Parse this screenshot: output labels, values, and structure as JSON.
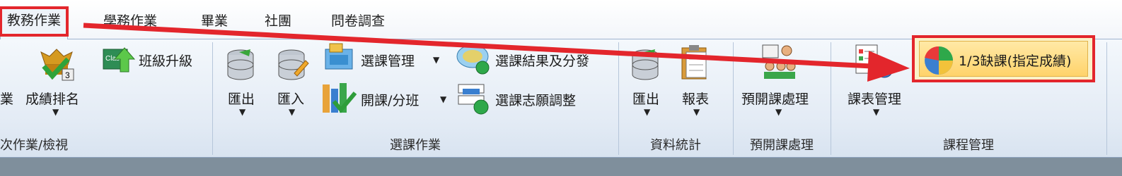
{
  "tabs": [
    {
      "label": "教務作業",
      "active": true
    },
    {
      "label": "學務作業"
    },
    {
      "label": "畢業"
    },
    {
      "label": "社團"
    },
    {
      "label": "問卷調查"
    }
  ],
  "group1": {
    "cut_label": "業",
    "rank_label": "成績排名",
    "promote_label": "班級升級",
    "group_label": "次作業/檢視"
  },
  "group2": {
    "export_label": "匯出",
    "import_label": "匯入",
    "manage_label": "選課管理",
    "open_label": "開課/分班",
    "result_label": "選課結果及分發",
    "adjust_label": "選課志願調整",
    "group_label": "選課作業"
  },
  "group3": {
    "export_label": "匯出",
    "report_label": "報表",
    "group_label": "資料統計"
  },
  "group4": {
    "preopen_label": "預開課處理",
    "group_label": "預開課處理"
  },
  "group5": {
    "schedule_label": "課表管理",
    "absence_label": "1/3缺課(指定成績)",
    "group_label": "課程管理"
  },
  "colors": {
    "highlight": "#e3262c",
    "arrow": "#e3262c"
  }
}
